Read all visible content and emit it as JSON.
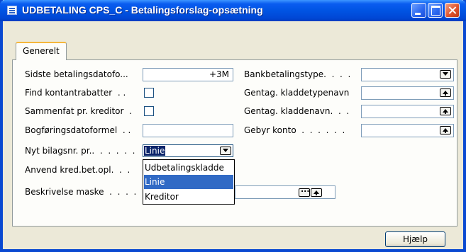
{
  "window": {
    "title": "UDBETALING CPS_C - Betalingsforslag-opsætning"
  },
  "tabs": [
    {
      "label": "Generelt"
    }
  ],
  "left_fields": {
    "sidste_betalingsdato": {
      "label": "Sidste betalingsdatofo...",
      "value": "+3M"
    },
    "find_kontantrabatter": {
      "label": "Find kontantrabatter  . ."
    },
    "sammenfat": {
      "label": "Sammenfat pr. kreditor  ."
    },
    "bogforingsdatoformel": {
      "label": "Bogføringsdatoformel  . ."
    },
    "nyt_bilagsnr": {
      "label": "Nyt bilagsnr. pr..  .  .  .  .  .",
      "value": "Linie"
    },
    "anvend_kred": {
      "label": "Anvend kred.bet.opl.  .  ."
    },
    "beskrivelse": {
      "label": "Beskrivelse maske  .  .  .  ."
    }
  },
  "right_fields": {
    "bankbetalingstype": {
      "label": "Bankbetalingstype.  .  .  ."
    },
    "gentag_kladdetypenavn": {
      "label": "Gentag. kladdetypenavn"
    },
    "gentag_kladdenavn": {
      "label": "Gentag. kladdenavn.  .  ."
    },
    "gebyr_konto": {
      "label": "Gebyr konto  .  .  .  .  .  ."
    }
  },
  "dropdown_options": [
    "Udbetalingskladde",
    "Linie",
    "Kreditor"
  ],
  "selected_option": "Linie",
  "buttons": {
    "help": "Hjælp"
  },
  "colors": {
    "titlebar": "#0054e3",
    "selection": "#316ac5",
    "tab_accent": "#f5b73b"
  }
}
